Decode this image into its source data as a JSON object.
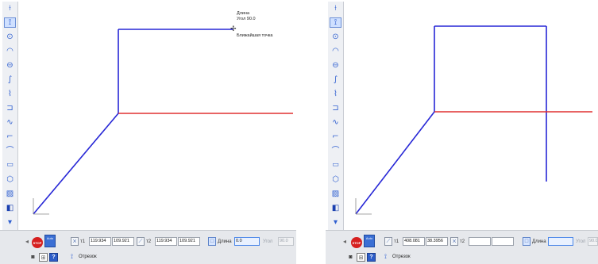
{
  "colors": {
    "construction_line": "#2727d6",
    "horizontal_line": "#e03030",
    "bottom_strip": "#e6e8ec",
    "toolbar": "#eef0f4",
    "stop_button": "#d61f1f",
    "highlight_field": "#4a86e8"
  },
  "toolbar": {
    "icons": [
      "axis-icon",
      "segment-icon",
      "circle-icon",
      "arc-icon",
      "ellipse-icon",
      "bezier-icon",
      "polyline-icon",
      "contour-icon",
      "spline-icon",
      "chamfer-icon",
      "fillet-icon",
      "rectangle-icon",
      "polygon-icon",
      "hatch-icon",
      "fill-icon",
      "more-icon"
    ],
    "active_icon": "segment-icon"
  },
  "left": {
    "tooltip": {
      "line1": "Длина",
      "line2": "Угол  90.0",
      "line3": "Ближайшая точка"
    },
    "properties": {
      "stop_label": "STOP",
      "auto_label": "Auto",
      "t1_label": "т1",
      "t1_x": "119.934",
      "t1_y": "109.921",
      "t2_label": "т2",
      "t2_x": "119.934",
      "t2_y": "109.921",
      "length_label": "Длина",
      "length_value": "0.0",
      "angle_label": "Угол",
      "angle_value": "90.0",
      "tool_name": "Отрезок"
    }
  },
  "right": {
    "properties": {
      "stop_label": "STOP",
      "auto_label": "Auto",
      "t1_label": "т1",
      "t1_x": "408.081",
      "t1_y": "38.3956",
      "t2_label": "т2",
      "t2_x": "",
      "t2_y": "",
      "length_label": "Длина",
      "length_value": "",
      "angle_label": "Угол",
      "angle_value": "90.0",
      "tool_name": "Отрезок"
    }
  }
}
